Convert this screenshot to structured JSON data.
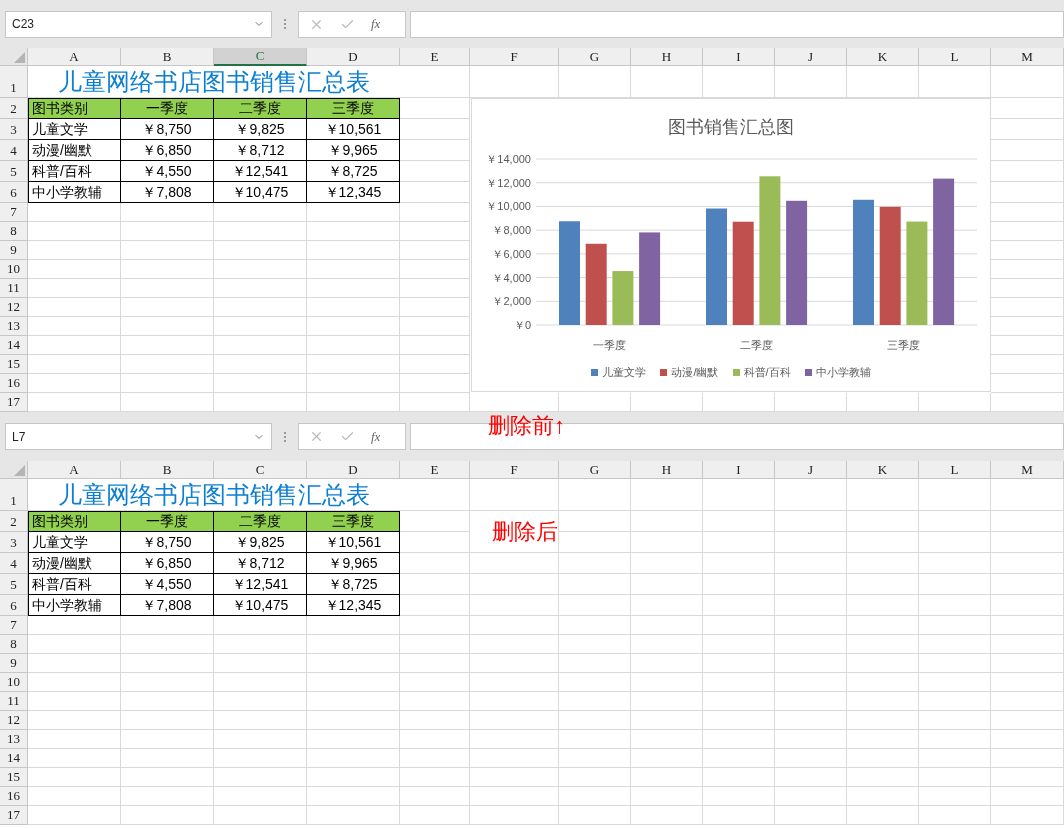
{
  "panes": [
    {
      "formula_bar": {
        "name_box": "C23",
        "function_label": "fx"
      },
      "columns": [
        {
          "label": "A",
          "selected": false
        },
        {
          "label": "B",
          "selected": false
        },
        {
          "label": "C",
          "selected": true
        },
        {
          "label": "D",
          "selected": false
        },
        {
          "label": "E",
          "selected": false
        },
        {
          "label": "F",
          "selected": false
        },
        {
          "label": "G",
          "selected": false
        },
        {
          "label": "H",
          "selected": false
        },
        {
          "label": "I",
          "selected": false
        },
        {
          "label": "J",
          "selected": false
        },
        {
          "label": "K",
          "selected": false
        },
        {
          "label": "L",
          "selected": false
        },
        {
          "label": "M",
          "selected": false
        }
      ],
      "rows": [
        "1",
        "2",
        "3",
        "4",
        "5",
        "6",
        "7",
        "8",
        "9",
        "10",
        "11",
        "12",
        "13",
        "14",
        "15",
        "16",
        "17"
      ],
      "sheet": {
        "title": "儿童网络书店图书销售汇总表",
        "header": [
          "图书类别",
          "一季度",
          "二季度",
          "三季度"
        ],
        "rows": [
          [
            "儿童文学",
            "￥8,750",
            "￥9,825",
            "￥10,561"
          ],
          [
            "动漫/幽默",
            "￥6,850",
            "￥8,712",
            "￥9,965"
          ],
          [
            "科普/百科",
            "￥4,550",
            "￥12,541",
            "￥8,725"
          ],
          [
            "中小学教辅",
            "￥7,808",
            "￥10,475",
            "￥12,345"
          ]
        ]
      },
      "chart": {
        "chart_data": {
          "type": "bar",
          "title": "图书销售汇总图",
          "categories": [
            "一季度",
            "二季度",
            "三季度"
          ],
          "series": [
            {
              "name": "儿童文学",
              "color": "#4f81bd",
              "values": [
                8750,
                9825,
                10561
              ]
            },
            {
              "name": "动漫/幽默",
              "color": "#c0504d",
              "values": [
                6850,
                8712,
                9965
              ]
            },
            {
              "name": "科普/百科",
              "color": "#9bbb59",
              "values": [
                4550,
                12541,
                8725
              ]
            },
            {
              "name": "中小学教辅",
              "color": "#8064a2",
              "values": [
                7808,
                10475,
                12345
              ]
            }
          ],
          "ylim": [
            0,
            14000
          ],
          "grid": true,
          "legend": true,
          "yticks": [
            {
              "value": 0,
              "label": "￥0"
            },
            {
              "value": 2000,
              "label": "￥2,000"
            },
            {
              "value": 4000,
              "label": "￥4,000"
            },
            {
              "value": 6000,
              "label": "￥6,000"
            },
            {
              "value": 8000,
              "label": "￥8,000"
            },
            {
              "value": 10000,
              "label": "￥10,000"
            },
            {
              "value": 12000,
              "label": "￥12,000"
            },
            {
              "value": 14000,
              "label": "￥14,000"
            }
          ]
        }
      },
      "annotation": "删除前↑"
    },
    {
      "formula_bar": {
        "name_box": "L7",
        "function_label": "fx"
      },
      "columns": [
        {
          "label": "A",
          "selected": false
        },
        {
          "label": "B",
          "selected": false
        },
        {
          "label": "C",
          "selected": false
        },
        {
          "label": "D",
          "selected": false
        },
        {
          "label": "E",
          "selected": false
        },
        {
          "label": "F",
          "selected": false
        },
        {
          "label": "G",
          "selected": false
        },
        {
          "label": "H",
          "selected": false
        },
        {
          "label": "I",
          "selected": false
        },
        {
          "label": "J",
          "selected": false
        },
        {
          "label": "K",
          "selected": false
        },
        {
          "label": "L",
          "selected": false
        },
        {
          "label": "M",
          "selected": false
        }
      ],
      "rows": [
        "1",
        "2",
        "3",
        "4",
        "5",
        "6",
        "7",
        "8",
        "9",
        "10",
        "11",
        "12",
        "13",
        "14",
        "15",
        "16",
        "17"
      ],
      "sheet": {
        "title": "儿童网络书店图书销售汇总表",
        "header": [
          "图书类别",
          "一季度",
          "二季度",
          "三季度"
        ],
        "rows": [
          [
            "儿童文学",
            "￥8,750",
            "￥9,825",
            "￥10,561"
          ],
          [
            "动漫/幽默",
            "￥6,850",
            "￥8,712",
            "￥9,965"
          ],
          [
            "科普/百科",
            "￥4,550",
            "￥12,541",
            "￥8,725"
          ],
          [
            "中小学教辅",
            "￥7,808",
            "￥10,475",
            "￥12,345"
          ]
        ]
      },
      "annotation": "删除后"
    }
  ]
}
